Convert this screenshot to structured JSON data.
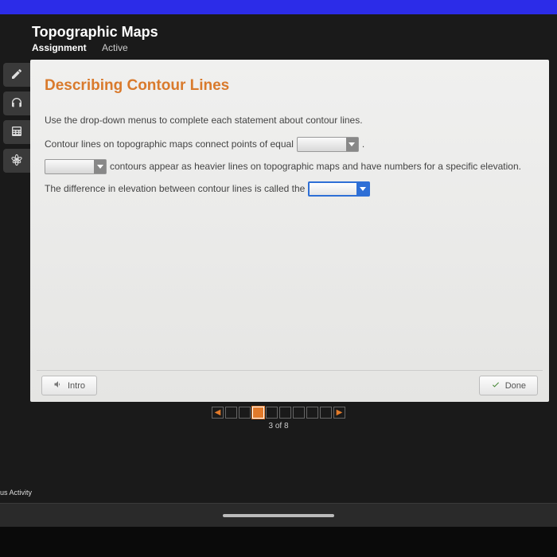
{
  "header": {
    "title": "Topographic Maps",
    "assignment_label": "Assignment",
    "status": "Active"
  },
  "content": {
    "title": "Describing Contour Lines",
    "instruction": "Use the drop-down menus to complete each statement about contour lines.",
    "s1a": "Contour lines on topographic maps connect points of equal",
    "s1b": ".",
    "s2b": "contours appear as heavier lines on topographic maps and have numbers for a specific elevation.",
    "s3a": "The difference in elevation between contour lines is called the"
  },
  "buttons": {
    "intro": "Intro",
    "done": "Done"
  },
  "pager": {
    "current": 3,
    "total": 8,
    "label": "3 of 8"
  },
  "footer": {
    "activity": "us Activity"
  }
}
